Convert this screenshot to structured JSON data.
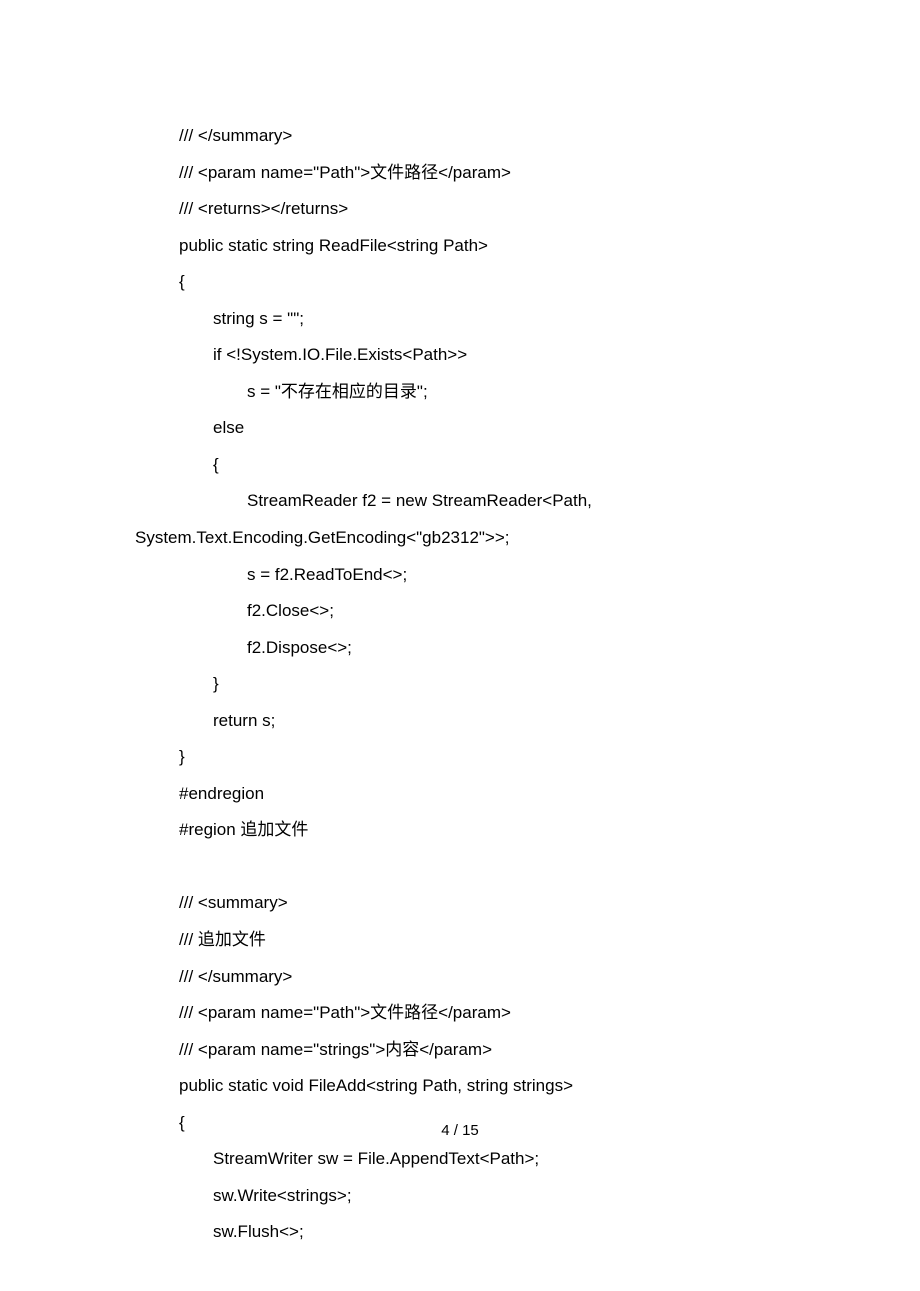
{
  "code": {
    "lines": [
      {
        "indent": "indent1",
        "text": "/// </summary>"
      },
      {
        "indent": "indent1",
        "text": "/// <param name=\"Path\">文件路径</param>"
      },
      {
        "indent": "indent1",
        "text": "/// <returns></returns>"
      },
      {
        "indent": "indent1",
        "text": "public static string ReadFile<string Path>"
      },
      {
        "indent": "indent1",
        "text": "{"
      },
      {
        "indent": "indent2",
        "text": "string s = \"\";"
      },
      {
        "indent": "indent2",
        "text": "if <!System.IO.File.Exists<Path>>"
      },
      {
        "indent": "indent3",
        "text": "s = \"不存在相应的目录\";"
      },
      {
        "indent": "indent2",
        "text": "else"
      },
      {
        "indent": "indent2",
        "text": "{"
      },
      {
        "indent": "indent3",
        "text": "StreamReader f2 = new StreamReader<Path,"
      },
      {
        "indent": "indent0",
        "text": "System.Text.Encoding.GetEncoding<\"gb2312\">>;"
      },
      {
        "indent": "indent3",
        "text": "s = f2.ReadToEnd<>;"
      },
      {
        "indent": "indent3",
        "text": "f2.Close<>;"
      },
      {
        "indent": "indent3",
        "text": "f2.Dispose<>;"
      },
      {
        "indent": "indent2",
        "text": "}"
      },
      {
        "indent": "indent2",
        "text": "return s;"
      },
      {
        "indent": "indent1",
        "text": "}"
      },
      {
        "indent": "indent1",
        "text": "#endregion"
      },
      {
        "indent": "indent1",
        "text": "#region 追加文件"
      },
      {
        "indent": "indent1",
        "text": ""
      },
      {
        "indent": "indent1",
        "text": "/// <summary>"
      },
      {
        "indent": "indent1",
        "text": "/// 追加文件"
      },
      {
        "indent": "indent1",
        "text": "/// </summary>"
      },
      {
        "indent": "indent1",
        "text": "/// <param name=\"Path\">文件路径</param>"
      },
      {
        "indent": "indent1",
        "text": "/// <param name=\"strings\">内容</param>"
      },
      {
        "indent": "indent1",
        "text": "public static void FileAdd<string Path, string strings>"
      },
      {
        "indent": "indent1",
        "text": "{"
      },
      {
        "indent": "indent2",
        "text": "StreamWriter sw = File.AppendText<Path>;"
      },
      {
        "indent": "indent2",
        "text": "sw.Write<strings>;"
      },
      {
        "indent": "indent2",
        "text": "sw.Flush<>;"
      }
    ]
  },
  "pagination": {
    "current": "4",
    "separator": " / ",
    "total": "15"
  }
}
